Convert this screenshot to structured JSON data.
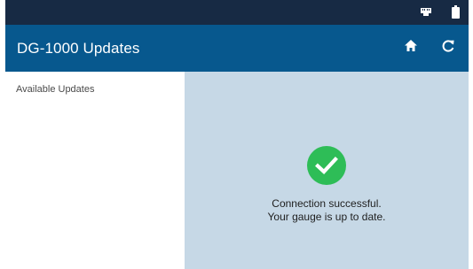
{
  "app_bar": {
    "title": "DG-1000 Updates",
    "home_icon": "home-icon",
    "refresh_icon": "refresh-icon"
  },
  "status_bar": {
    "icons": [
      "ethernet-icon",
      "battery-icon"
    ]
  },
  "sidebar": {
    "label": "Available Updates"
  },
  "content": {
    "status_icon": "check-circle-icon",
    "line1": "Connection successful.",
    "line2": "Your gauge is up to date."
  },
  "colors": {
    "status_bar": "#172a44",
    "app_bar": "#07588e",
    "content_bg": "#c6d8e6",
    "success": "#2ebd57"
  }
}
